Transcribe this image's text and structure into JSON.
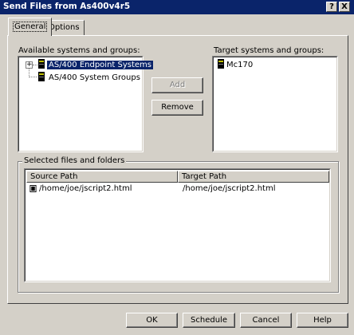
{
  "window": {
    "title": "Send Files from As400v4r5",
    "help_btn": "?",
    "close_btn": "X"
  },
  "tabs": [
    {
      "label": "General",
      "active": true
    },
    {
      "label": "Options",
      "active": false
    }
  ],
  "available": {
    "label": "Available systems and groups:",
    "items": [
      {
        "label": "AS/400 Endpoint Systems",
        "selected": true,
        "expander": "+"
      },
      {
        "label": "AS/400 System Groups",
        "selected": false,
        "expander": ""
      }
    ]
  },
  "buttons": {
    "add": "Add",
    "remove": "Remove"
  },
  "target": {
    "label": "Target systems and groups:",
    "items": [
      {
        "label": "Mc170"
      }
    ]
  },
  "files": {
    "group_label": "Selected files and folders",
    "columns": [
      "Source Path",
      "Target Path"
    ],
    "rows": [
      {
        "source": "/home/joe/jscript2.html",
        "target": "/home/joe/jscript2.html"
      }
    ]
  },
  "footer": {
    "ok": "OK",
    "schedule": "Schedule",
    "cancel": "Cancel",
    "help": "Help"
  },
  "colors": {
    "titlebar": "#0a246a",
    "face": "#d4d0c8",
    "selection": "#0a246a"
  }
}
